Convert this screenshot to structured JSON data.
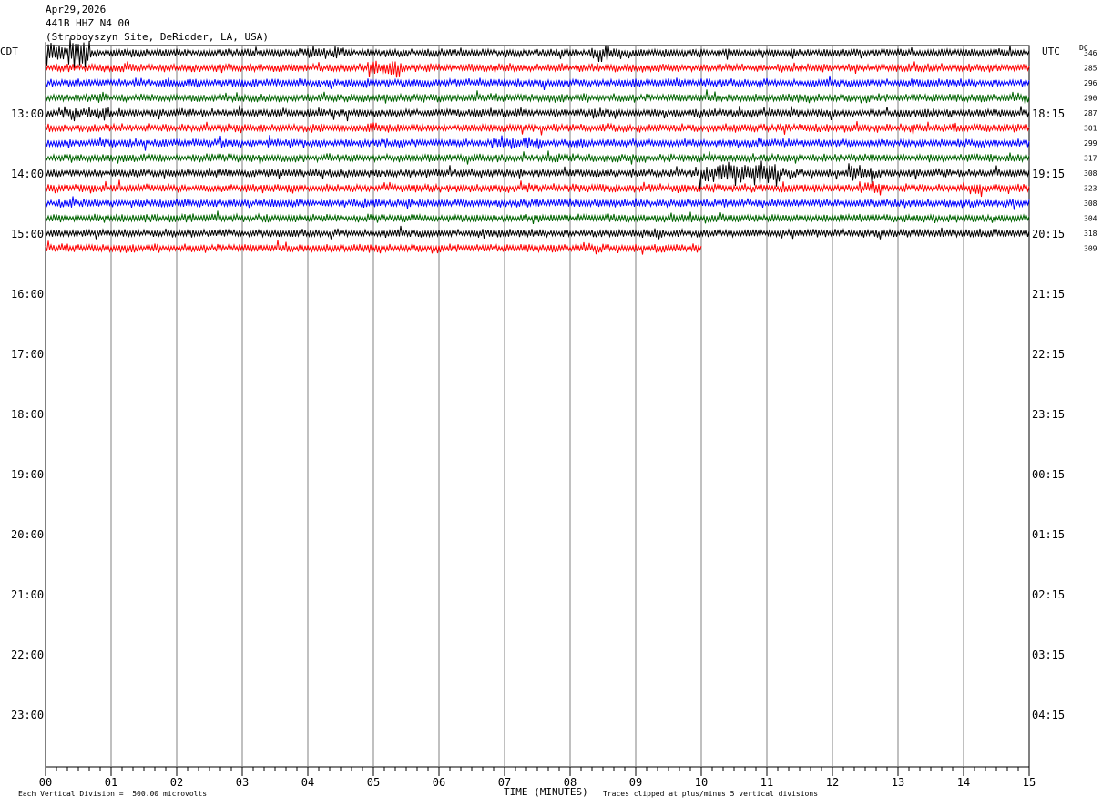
{
  "header": {
    "date": "Apr29,2026",
    "channel": "441B HHZ N4 00",
    "site": "(Stroboyszyn Site, DeRidder, LA, USA)"
  },
  "left_zone": "CDT",
  "right_zone": "UTC",
  "dc_label": "DC",
  "chart_data": {
    "type": "line",
    "title": "Helicorder 441B HHZ N4 00",
    "xlabel": "TIME (MINUTES)",
    "xlim": [
      0,
      15
    ],
    "x_ticks": [
      "00",
      "01",
      "02",
      "03",
      "04",
      "05",
      "06",
      "07",
      "08",
      "09",
      "10",
      "11",
      "12",
      "13",
      "14",
      "15"
    ],
    "left_hour_labels": [
      "13:00",
      "14:00",
      "15:00",
      "16:00",
      "17:00",
      "18:00",
      "19:00",
      "20:00",
      "21:00",
      "22:00",
      "23:00"
    ],
    "right_hour_labels": [
      "18:15",
      "19:15",
      "20:15",
      "21:15",
      "22:15",
      "23:15",
      "00:15",
      "01:15",
      "02:15",
      "03:15",
      "04:15"
    ],
    "trace_colors": [
      "#000000",
      "#ff0000",
      "#0000ff",
      "#006400"
    ],
    "dc_offsets": [
      "346",
      "285",
      "296",
      "290",
      "287",
      "301",
      "299",
      "317",
      "308",
      "323",
      "308",
      "304",
      "318",
      "309"
    ],
    "trace_count": 14,
    "last_trace_end_minutes": 10,
    "events": [
      {
        "trace": 0,
        "start": 0.0,
        "end": 0.7,
        "amp": 3.0
      },
      {
        "trace": 0,
        "start": 4.0,
        "end": 4.6,
        "amp": 1.4
      },
      {
        "trace": 0,
        "start": 8.3,
        "end": 8.8,
        "amp": 1.8
      },
      {
        "trace": 1,
        "start": 4.9,
        "end": 5.5,
        "amp": 2.0
      },
      {
        "trace": 4,
        "start": 0.2,
        "end": 1.0,
        "amp": 1.6
      },
      {
        "trace": 4,
        "start": 8.3,
        "end": 8.7,
        "amp": 1.5
      },
      {
        "trace": 5,
        "start": 4.9,
        "end": 5.1,
        "amp": 1.6
      },
      {
        "trace": 6,
        "start": 6.8,
        "end": 7.6,
        "amp": 1.6
      },
      {
        "trace": 8,
        "start": 9.9,
        "end": 11.2,
        "amp": 2.6
      },
      {
        "trace": 8,
        "start": 12.2,
        "end": 12.7,
        "amp": 1.7
      },
      {
        "trace": 9,
        "start": 12.4,
        "end": 12.8,
        "amp": 1.5
      },
      {
        "trace": 9,
        "start": 14.1,
        "end": 14.3,
        "amp": 1.6
      },
      {
        "trace": 11,
        "start": 9.8,
        "end": 10.3,
        "amp": 1.3
      }
    ]
  },
  "footer": {
    "scale_note": "Each Vertical Division =  500.00 microvolts",
    "clip_note": "Traces clipped at plus/minus 5 vertical divisions"
  }
}
